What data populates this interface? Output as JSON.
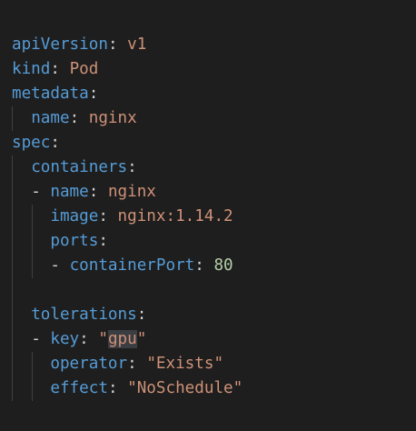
{
  "editor": {
    "language": "yaml",
    "colors": {
      "background": "#1e1e1e",
      "key": "#569cd6",
      "string": "#ce9178",
      "number": "#b5cea8",
      "punctuation": "#d4d4d4",
      "highlight": "#3a3d41"
    },
    "lines": [
      {
        "k": "apiVersion",
        "v": "v1"
      },
      {
        "k": "kind",
        "v": "Pod"
      },
      {
        "k": "metadata"
      },
      {
        "k": "name",
        "v": "nginx"
      },
      {
        "k": "spec"
      },
      {
        "k": "containers"
      },
      {
        "dash": "- ",
        "k": "name",
        "v": "nginx"
      },
      {
        "k": "image",
        "v": "nginx:1.14.2"
      },
      {
        "k": "ports"
      },
      {
        "dash": "- ",
        "k": "containerPort",
        "v": "80"
      },
      {},
      {
        "k": "tolerations"
      },
      {
        "dash": "- ",
        "k": "key",
        "q1": "\"",
        "v": "gpu",
        "q2": "\""
      },
      {
        "k": "operator",
        "v": "\"Exists\""
      },
      {
        "k": "effect",
        "v": "\"NoSchedule\""
      }
    ]
  }
}
